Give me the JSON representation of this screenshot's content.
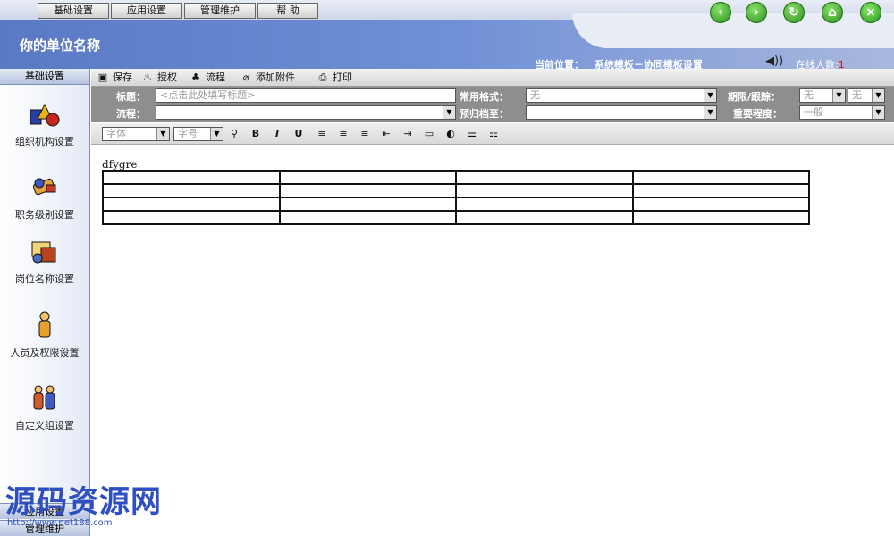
{
  "top_menu": {
    "items": [
      "基础设置",
      "应用设置",
      "管理维护",
      "帮 助"
    ]
  },
  "header": {
    "unit_name": "你的单位名称",
    "location_label": "当前位置：",
    "location_path": "系统模板－协同模板设置",
    "online_label": "在线人数:",
    "online_count": "1",
    "nav_icons": [
      "back-icon",
      "forward-icon",
      "refresh-icon",
      "home-icon",
      "close-icon"
    ]
  },
  "sidebar": {
    "head": "基础设置",
    "items": [
      {
        "label": "组织机构设置",
        "icon": "org-icon"
      },
      {
        "label": "职务级别设置",
        "icon": "rank-icon"
      },
      {
        "label": "岗位名称设置",
        "icon": "post-icon"
      },
      {
        "label": "人员及权限设置",
        "icon": "user-icon"
      },
      {
        "label": "自定义组设置",
        "icon": "group-icon"
      }
    ],
    "bottom": [
      "应用设置",
      "管理维护"
    ]
  },
  "toolbar": {
    "save": "保存",
    "authorize": "授权",
    "flow": "流程",
    "attach": "添加附件",
    "print": "打印"
  },
  "form": {
    "title_label": "标题：",
    "title_placeholder": "<点击此处填写标题>",
    "flow_label": "流程：",
    "format_label": "常用格式：",
    "format_value": "无",
    "archive_label": "预归档至：",
    "deadline_label": "期限/跟踪：",
    "deadline_value": "无",
    "track_value": "无",
    "priority_label": "重要程度：",
    "priority_value": "一般"
  },
  "editor_toolbar": {
    "font_placeholder": "字体",
    "size_placeholder": "字号"
  },
  "document": {
    "text": "dfygre",
    "table_rows": 4,
    "table_cols": 4
  },
  "watermark": {
    "title": "源码资源网",
    "url": "http://www.net188.com"
  }
}
